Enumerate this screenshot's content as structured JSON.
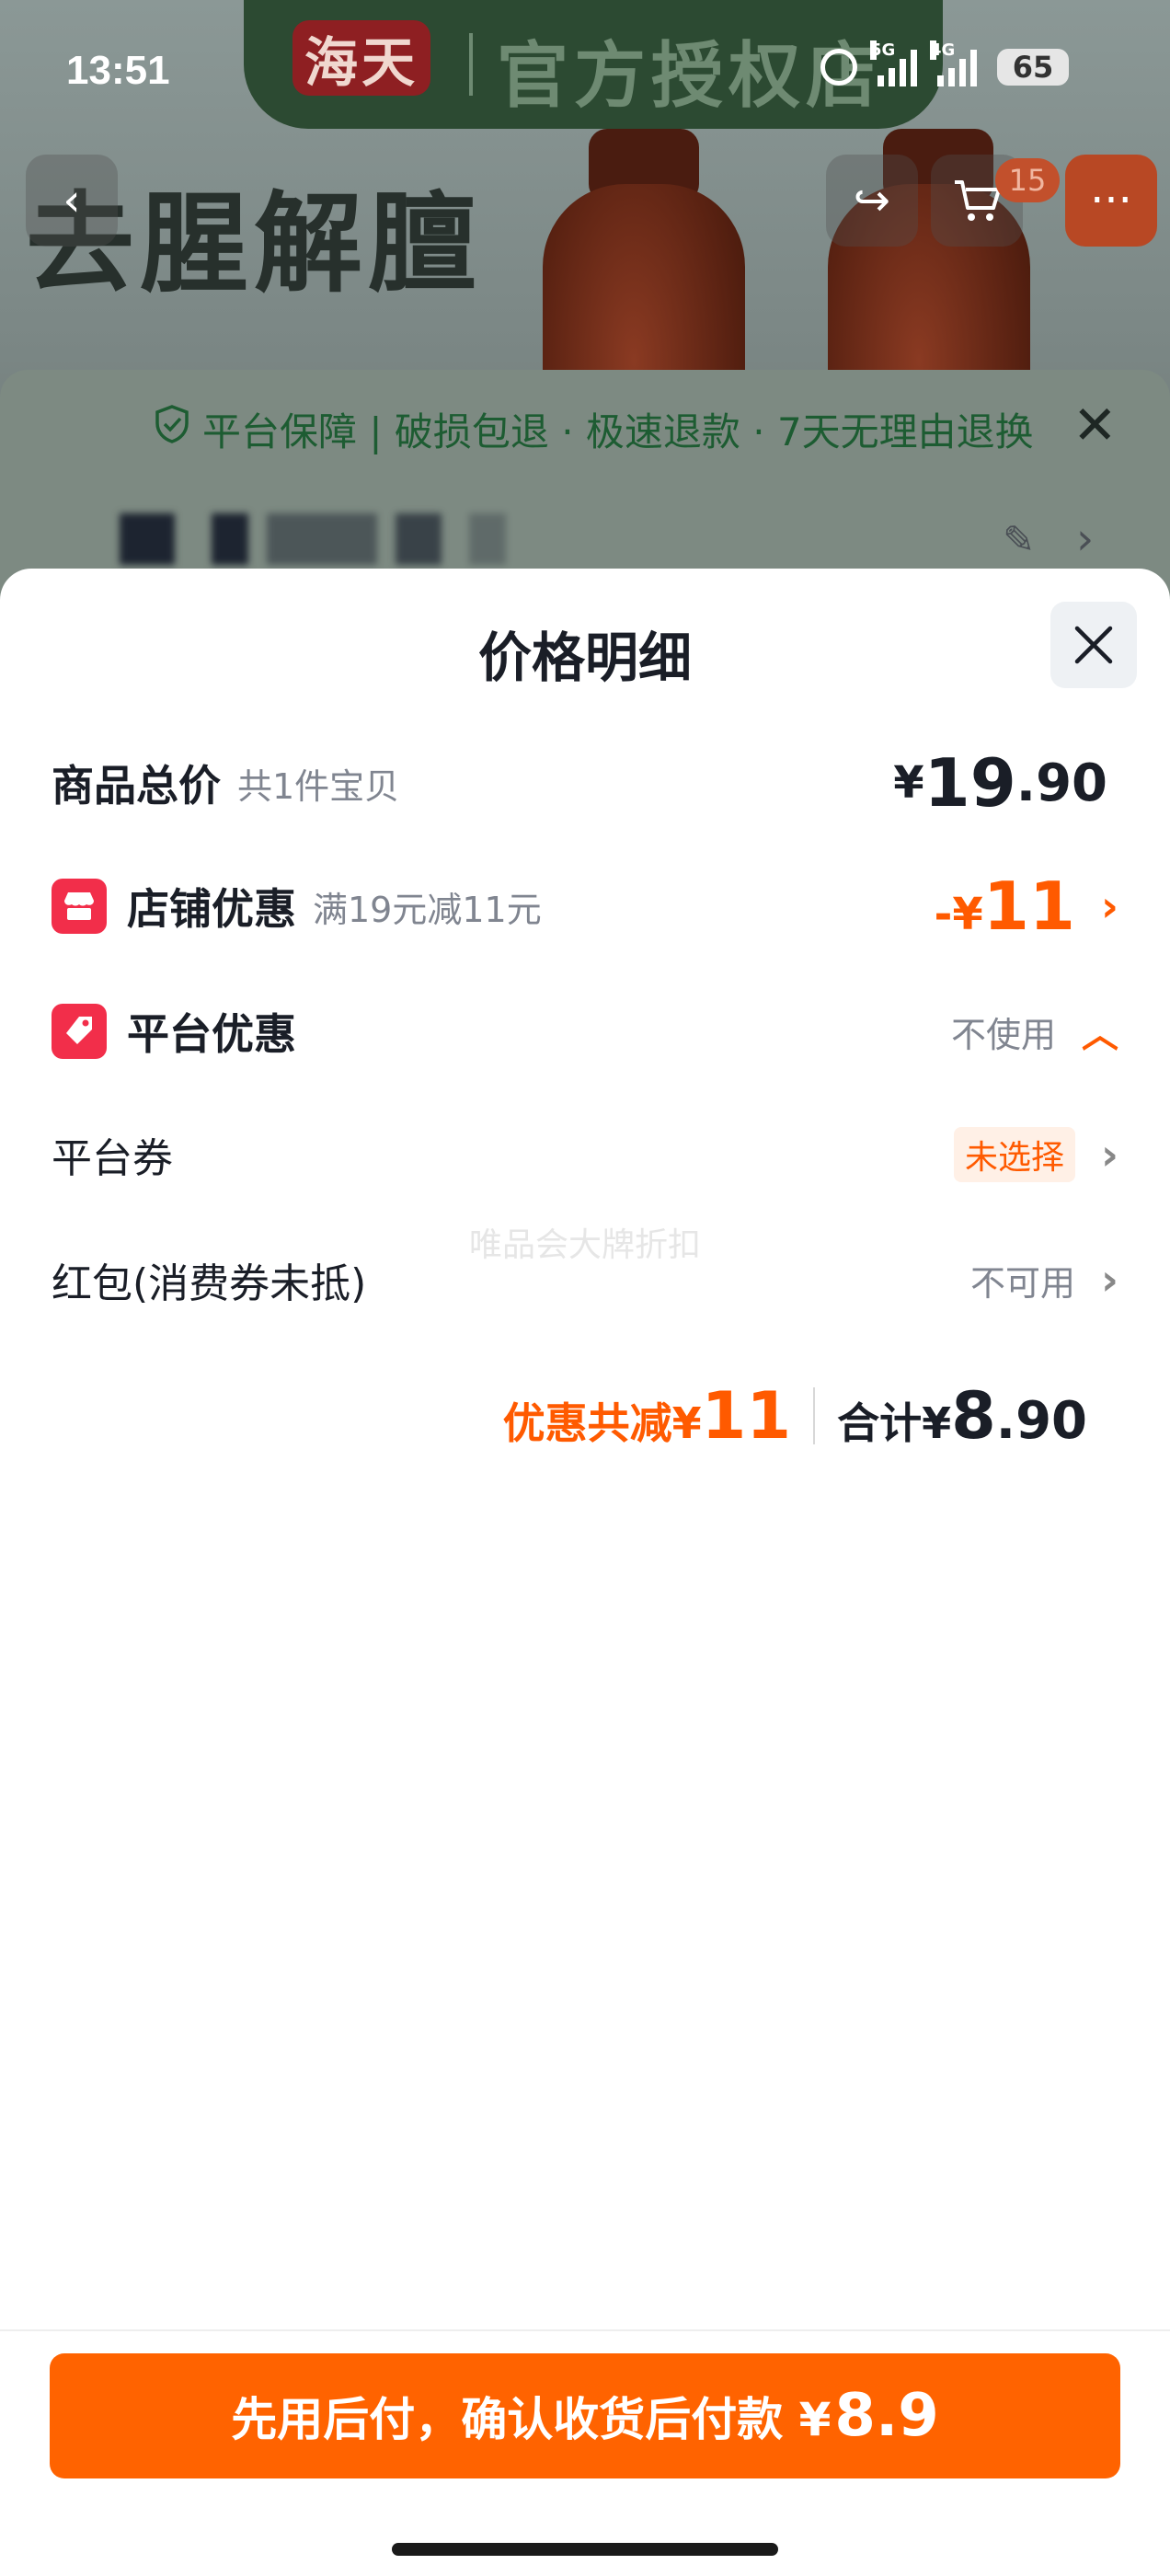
{
  "status_bar": {
    "time": "13:51",
    "net_5g": "5G",
    "net_4g": "4G",
    "battery": "65"
  },
  "background_page": {
    "brand_logo": "海天",
    "store_tag": "官方授权店",
    "slogan": "去腥解膻",
    "cart_count": "15",
    "guarantee": "平台保障 | 破损包退 · 极速退款 · 7天无理由退换"
  },
  "sheet": {
    "title": "价格明细",
    "watermark": "唯品会大牌折扣",
    "rows": {
      "total": {
        "label": "商品总价",
        "sub": "共1件宝贝",
        "yen": "¥",
        "int": "19",
        "dec": ".90"
      },
      "store": {
        "label": "店铺优惠",
        "sub": "满19元减11元",
        "prefix": "-¥",
        "int": "11"
      },
      "platform": {
        "label": "平台优惠",
        "status": "不使用"
      },
      "coupon": {
        "label": "平台券",
        "status": "未选择"
      },
      "hongbao": {
        "label": "红包(消费券未抵)",
        "status": "不可用"
      }
    },
    "summary": {
      "discount_label": "优惠共减¥",
      "discount_int": "11",
      "total_label": "合计¥",
      "total_int": "8",
      "total_dec": ".90"
    }
  },
  "pay_button": {
    "label": "先用后付，确认收货后付款 ¥",
    "amount": "8.9"
  },
  "colors": {
    "accent": "#ff6300",
    "discount": "#ff5a00",
    "tag_red": "#f22e4a",
    "text_dark": "#1a1e27",
    "text_gray": "#808590"
  }
}
